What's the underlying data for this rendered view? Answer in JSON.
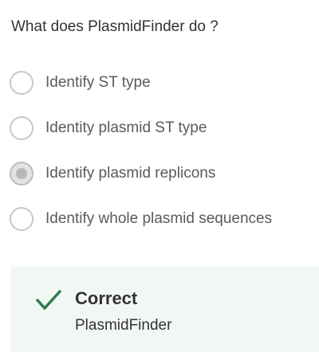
{
  "question": {
    "text": "What does PlasmidFinder do ?"
  },
  "options": [
    {
      "label": "Identify ST type",
      "selected": false
    },
    {
      "label": "Identity plasmid ST type",
      "selected": false
    },
    {
      "label": "Identify plasmid replicons",
      "selected": true
    },
    {
      "label": "Identify whole plasmid sequences",
      "selected": false
    }
  ],
  "feedback": {
    "status": "Correct",
    "detail": "PlasmidFinder",
    "icon": "checkmark-icon",
    "color": "#2e7d4f",
    "background": "#f2f7f4"
  }
}
